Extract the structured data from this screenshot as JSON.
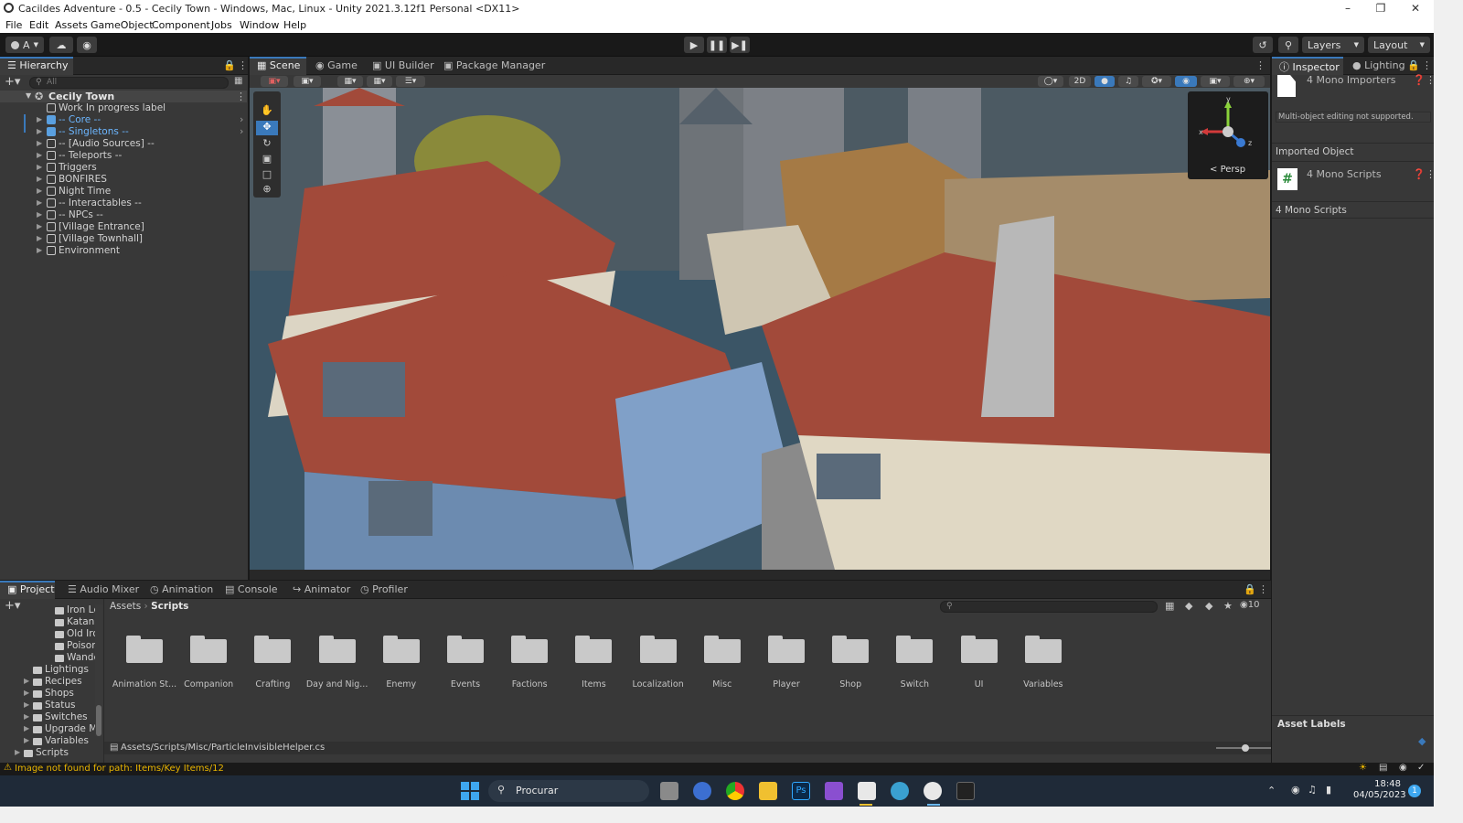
{
  "window": {
    "title": "Cacildes Adventure - 0.5 - Cecily Town - Windows, Mac, Linux - Unity 2021.3.12f1 Personal <DX11>"
  },
  "menu": [
    "File",
    "Edit",
    "Assets",
    "GameObject",
    "Component",
    "Jobs",
    "Window",
    "Help"
  ],
  "toolbar": {
    "account": "A",
    "layers": "Layers",
    "layout": "Layout"
  },
  "hierarchy": {
    "title": "Hierarchy",
    "search_placeholder": "All",
    "scene": "Cecily Town",
    "items": [
      "Work In progress label",
      "-- Core --",
      "-- Singletons --",
      "-- [Audio Sources] --",
      "-- Teleports --",
      "Triggers",
      "BONFIRES",
      "Night Time",
      "-- Interactables --",
      "-- NPCs --",
      "[Village Entrance]",
      "[Village Townhall]",
      "Environment"
    ]
  },
  "scene_tabs": [
    "Scene",
    "Game",
    "UI Builder",
    "Package Manager"
  ],
  "scene_toolbar": {
    "mode_2d": "2D"
  },
  "gizmo": {
    "persp": "Persp",
    "x": "x",
    "y": "y",
    "z": "z"
  },
  "inspector": {
    "tabs": [
      "Inspector",
      "Lighting"
    ],
    "importers": "4 Mono Importers",
    "notice": "Multi-object editing not supported.",
    "imported_object": "Imported Object",
    "scripts": "4 Mono Scripts",
    "scripts_header": "4 Mono Scripts",
    "asset_labels": "Asset Labels"
  },
  "project": {
    "tabs": [
      "Project",
      "Audio Mixer",
      "Animation",
      "Console",
      "Animator",
      "Profiler"
    ],
    "visible_count": "10",
    "breadcrumb": [
      "Assets",
      "Scripts"
    ],
    "tree": [
      {
        "label": "Iron Lc",
        "indent": 4
      },
      {
        "label": "Katana",
        "indent": 4
      },
      {
        "label": "Old Iro",
        "indent": 4
      },
      {
        "label": "Poisor",
        "indent": 4
      },
      {
        "label": "Wande",
        "indent": 4
      },
      {
        "label": "Lightings",
        "indent": 3
      },
      {
        "label": "Recipes",
        "indent": 3
      },
      {
        "label": "Shops",
        "indent": 3
      },
      {
        "label": "Status",
        "indent": 3
      },
      {
        "label": "Switches",
        "indent": 3
      },
      {
        "label": "Upgrade M",
        "indent": 3
      },
      {
        "label": "Variables",
        "indent": 3
      },
      {
        "label": "Scripts",
        "indent": 2
      }
    ],
    "folders": [
      "Animation St...",
      "Companion",
      "Crafting",
      "Day and Nig...",
      "Enemy",
      "Events",
      "Factions",
      "Items",
      "Localization",
      "Misc",
      "Player",
      "Shop",
      "Switch",
      "UI",
      "Variables"
    ],
    "selected_path": "Assets/Scripts/Misc/ParticleInvisibleHelper.cs"
  },
  "status": {
    "message": "Image not found for path: Items/Key Items/12"
  },
  "taskbar": {
    "search": "Procurar",
    "time": "18:48",
    "date": "04/05/2023",
    "notifications": "1"
  }
}
